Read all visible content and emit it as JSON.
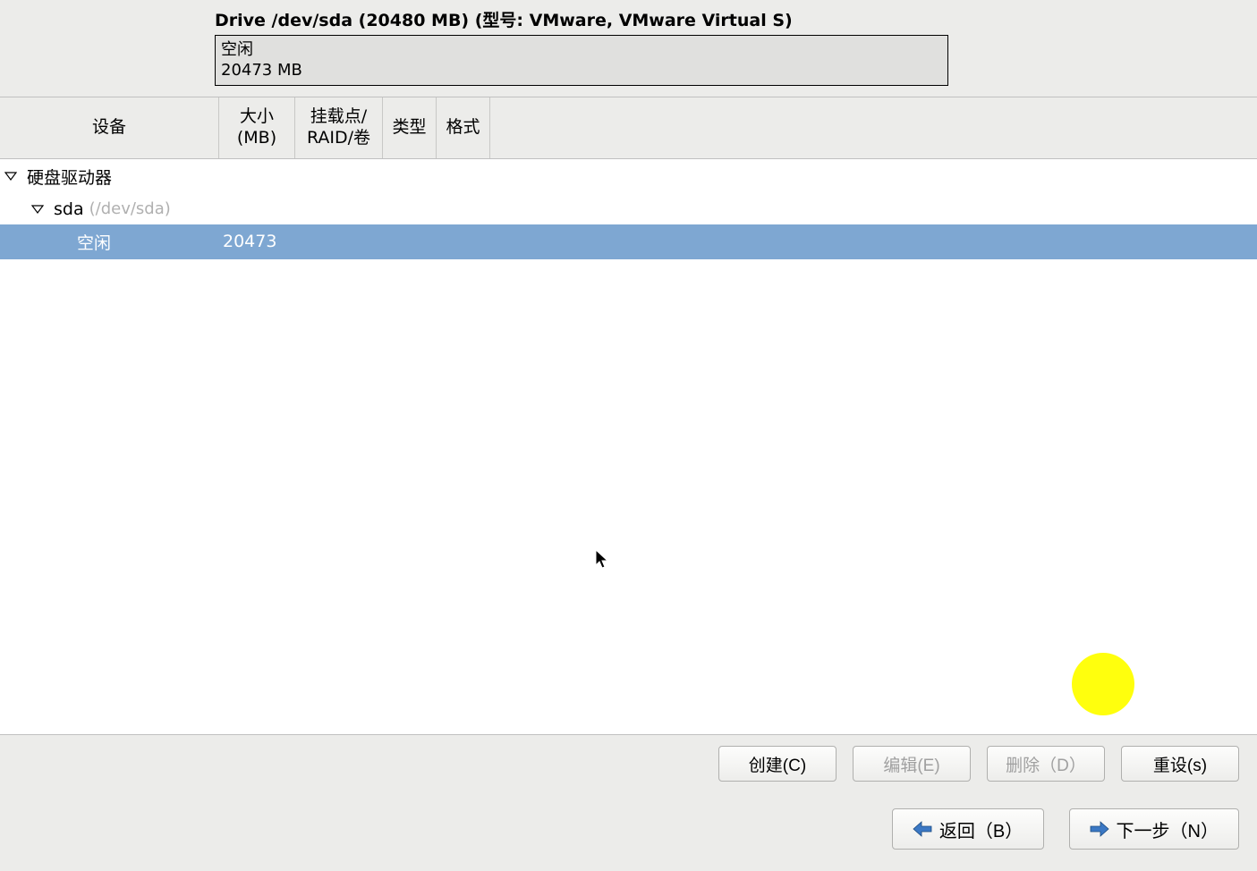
{
  "drive": {
    "title": "Drive /dev/sda (20480 MB) (型号: VMware, VMware Virtual S)",
    "box_line1": "空闲",
    "box_line2": "20473 MB"
  },
  "columns": {
    "device": "设备",
    "size_line1": "大小",
    "size_line2": "(MB)",
    "mount_line1": "挂载点/",
    "mount_line2": "RAID/卷",
    "type": "类型",
    "format": "格式"
  },
  "tree": {
    "root_label": "硬盘驱动器",
    "sda_label": "sda",
    "sda_path": "(/dev/sda)",
    "free_label": "空闲",
    "free_size": "20473"
  },
  "buttons": {
    "create": "创建(C)",
    "edit": "编辑(E)",
    "delete": "删除（D）",
    "reset": "重设(s)"
  },
  "nav": {
    "back": "返回（B）",
    "next": "下一步（N）"
  }
}
